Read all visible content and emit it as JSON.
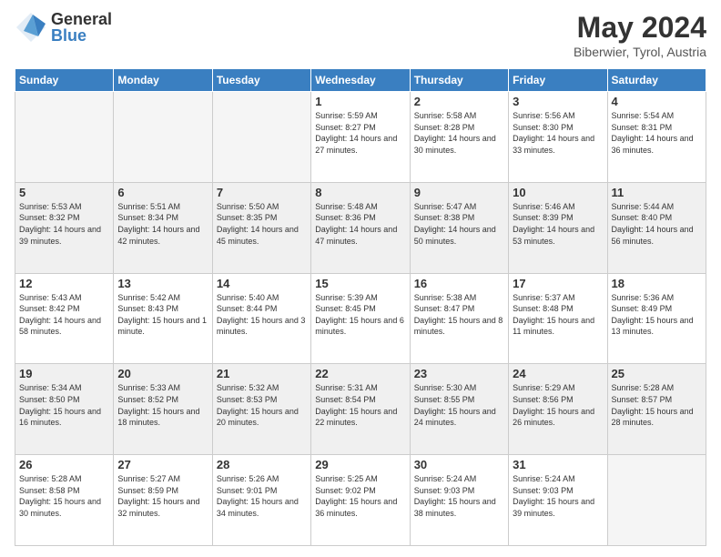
{
  "header": {
    "logo_general": "General",
    "logo_blue": "Blue",
    "month_title": "May 2024",
    "location": "Biberwier, Tyrol, Austria"
  },
  "days_of_week": [
    "Sunday",
    "Monday",
    "Tuesday",
    "Wednesday",
    "Thursday",
    "Friday",
    "Saturday"
  ],
  "weeks": [
    [
      {
        "day": "",
        "empty": true
      },
      {
        "day": "",
        "empty": true
      },
      {
        "day": "",
        "empty": true
      },
      {
        "day": "1",
        "sunrise": "5:59 AM",
        "sunset": "8:27 PM",
        "daylight": "14 hours and 27 minutes."
      },
      {
        "day": "2",
        "sunrise": "5:58 AM",
        "sunset": "8:28 PM",
        "daylight": "14 hours and 30 minutes."
      },
      {
        "day": "3",
        "sunrise": "5:56 AM",
        "sunset": "8:30 PM",
        "daylight": "14 hours and 33 minutes."
      },
      {
        "day": "4",
        "sunrise": "5:54 AM",
        "sunset": "8:31 PM",
        "daylight": "14 hours and 36 minutes."
      }
    ],
    [
      {
        "day": "5",
        "sunrise": "5:53 AM",
        "sunset": "8:32 PM",
        "daylight": "14 hours and 39 minutes."
      },
      {
        "day": "6",
        "sunrise": "5:51 AM",
        "sunset": "8:34 PM",
        "daylight": "14 hours and 42 minutes."
      },
      {
        "day": "7",
        "sunrise": "5:50 AM",
        "sunset": "8:35 PM",
        "daylight": "14 hours and 45 minutes."
      },
      {
        "day": "8",
        "sunrise": "5:48 AM",
        "sunset": "8:36 PM",
        "daylight": "14 hours and 47 minutes."
      },
      {
        "day": "9",
        "sunrise": "5:47 AM",
        "sunset": "8:38 PM",
        "daylight": "14 hours and 50 minutes."
      },
      {
        "day": "10",
        "sunrise": "5:46 AM",
        "sunset": "8:39 PM",
        "daylight": "14 hours and 53 minutes."
      },
      {
        "day": "11",
        "sunrise": "5:44 AM",
        "sunset": "8:40 PM",
        "daylight": "14 hours and 56 minutes."
      }
    ],
    [
      {
        "day": "12",
        "sunrise": "5:43 AM",
        "sunset": "8:42 PM",
        "daylight": "14 hours and 58 minutes."
      },
      {
        "day": "13",
        "sunrise": "5:42 AM",
        "sunset": "8:43 PM",
        "daylight": "15 hours and 1 minute."
      },
      {
        "day": "14",
        "sunrise": "5:40 AM",
        "sunset": "8:44 PM",
        "daylight": "15 hours and 3 minutes."
      },
      {
        "day": "15",
        "sunrise": "5:39 AM",
        "sunset": "8:45 PM",
        "daylight": "15 hours and 6 minutes."
      },
      {
        "day": "16",
        "sunrise": "5:38 AM",
        "sunset": "8:47 PM",
        "daylight": "15 hours and 8 minutes."
      },
      {
        "day": "17",
        "sunrise": "5:37 AM",
        "sunset": "8:48 PM",
        "daylight": "15 hours and 11 minutes."
      },
      {
        "day": "18",
        "sunrise": "5:36 AM",
        "sunset": "8:49 PM",
        "daylight": "15 hours and 13 minutes."
      }
    ],
    [
      {
        "day": "19",
        "sunrise": "5:34 AM",
        "sunset": "8:50 PM",
        "daylight": "15 hours and 16 minutes."
      },
      {
        "day": "20",
        "sunrise": "5:33 AM",
        "sunset": "8:52 PM",
        "daylight": "15 hours and 18 minutes."
      },
      {
        "day": "21",
        "sunrise": "5:32 AM",
        "sunset": "8:53 PM",
        "daylight": "15 hours and 20 minutes."
      },
      {
        "day": "22",
        "sunrise": "5:31 AM",
        "sunset": "8:54 PM",
        "daylight": "15 hours and 22 minutes."
      },
      {
        "day": "23",
        "sunrise": "5:30 AM",
        "sunset": "8:55 PM",
        "daylight": "15 hours and 24 minutes."
      },
      {
        "day": "24",
        "sunrise": "5:29 AM",
        "sunset": "8:56 PM",
        "daylight": "15 hours and 26 minutes."
      },
      {
        "day": "25",
        "sunrise": "5:28 AM",
        "sunset": "8:57 PM",
        "daylight": "15 hours and 28 minutes."
      }
    ],
    [
      {
        "day": "26",
        "sunrise": "5:28 AM",
        "sunset": "8:58 PM",
        "daylight": "15 hours and 30 minutes."
      },
      {
        "day": "27",
        "sunrise": "5:27 AM",
        "sunset": "8:59 PM",
        "daylight": "15 hours and 32 minutes."
      },
      {
        "day": "28",
        "sunrise": "5:26 AM",
        "sunset": "9:01 PM",
        "daylight": "15 hours and 34 minutes."
      },
      {
        "day": "29",
        "sunrise": "5:25 AM",
        "sunset": "9:02 PM",
        "daylight": "15 hours and 36 minutes."
      },
      {
        "day": "30",
        "sunrise": "5:24 AM",
        "sunset": "9:03 PM",
        "daylight": "15 hours and 38 minutes."
      },
      {
        "day": "31",
        "sunrise": "5:24 AM",
        "sunset": "9:03 PM",
        "daylight": "15 hours and 39 minutes."
      },
      {
        "day": "",
        "empty": true
      }
    ]
  ],
  "labels": {
    "sunrise_prefix": "Sunrise: ",
    "sunset_prefix": "Sunset: ",
    "daylight_prefix": "Daylight: "
  }
}
